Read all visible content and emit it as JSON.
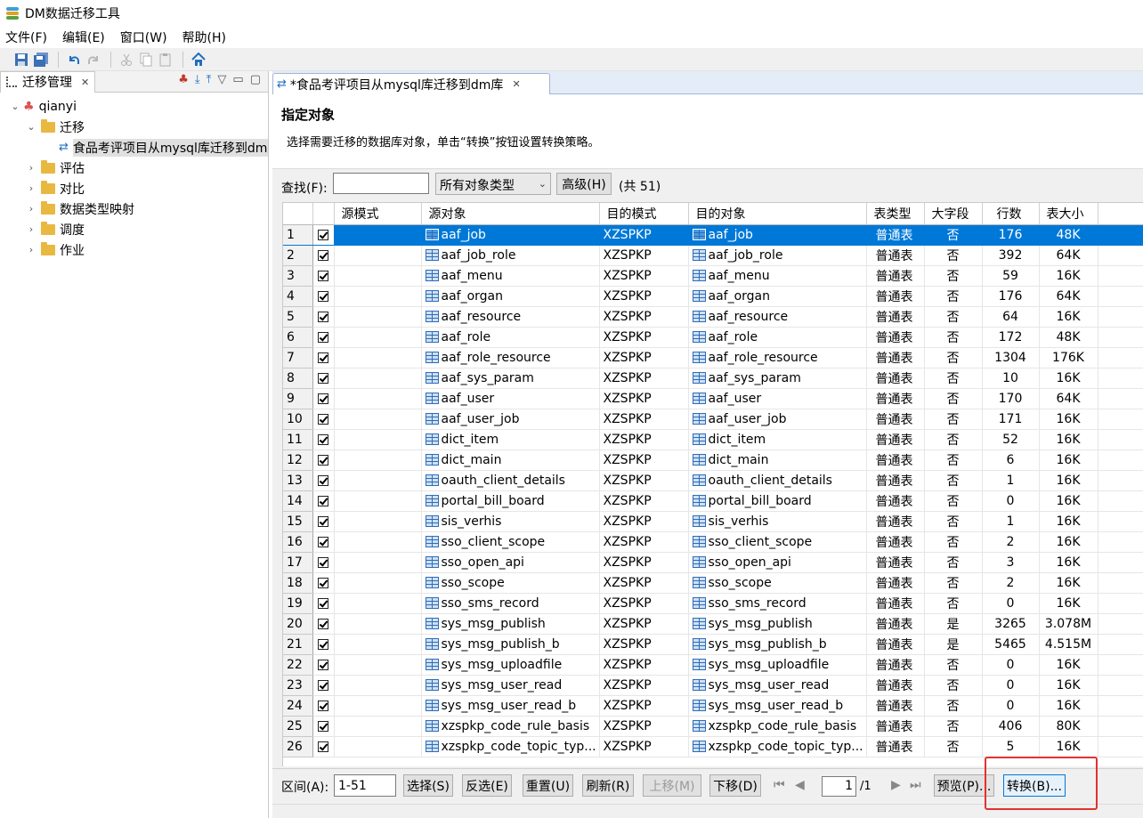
{
  "window": {
    "title": "DM数据迁移工具"
  },
  "menu": [
    "文件(F)",
    "编辑(E)",
    "窗口(W)",
    "帮助(H)"
  ],
  "left_panel": {
    "tab_label": "迁移管理",
    "tree": {
      "root": "qianyi",
      "migration_folder": "迁移",
      "migration_item": "食品考评项目从mysql库迁移到dm库",
      "folders": [
        "评估",
        "对比",
        "数据类型映射",
        "调度",
        "作业"
      ]
    }
  },
  "editor": {
    "tab_label": "*食品考评项目从mysql库迁移到dm库",
    "heading": "指定对象",
    "description": "选择需要迁移的数据库对象，单击“转换”按钮设置转换策略。",
    "search_label": "查找(F):",
    "search_value": "",
    "type_select": "所有对象类型",
    "advanced_button": "高级(H)",
    "count_text": "(共 51)",
    "columns": [
      "源模式",
      "源对象",
      "目的模式",
      "目的对象",
      "表类型",
      "大字段",
      "行数",
      "表大小"
    ],
    "rows": [
      {
        "n": "1",
        "obj": "aaf_job",
        "schema": "XZSPKP",
        "type": "普通表",
        "lob": "否",
        "rows": "176",
        "size": "48K"
      },
      {
        "n": "2",
        "obj": "aaf_job_role",
        "schema": "XZSPKP",
        "type": "普通表",
        "lob": "否",
        "rows": "392",
        "size": "64K"
      },
      {
        "n": "3",
        "obj": "aaf_menu",
        "schema": "XZSPKP",
        "type": "普通表",
        "lob": "否",
        "rows": "59",
        "size": "16K"
      },
      {
        "n": "4",
        "obj": "aaf_organ",
        "schema": "XZSPKP",
        "type": "普通表",
        "lob": "否",
        "rows": "176",
        "size": "64K"
      },
      {
        "n": "5",
        "obj": "aaf_resource",
        "schema": "XZSPKP",
        "type": "普通表",
        "lob": "否",
        "rows": "64",
        "size": "16K"
      },
      {
        "n": "6",
        "obj": "aaf_role",
        "schema": "XZSPKP",
        "type": "普通表",
        "lob": "否",
        "rows": "172",
        "size": "48K"
      },
      {
        "n": "7",
        "obj": "aaf_role_resource",
        "schema": "XZSPKP",
        "type": "普通表",
        "lob": "否",
        "rows": "1304",
        "size": "176K"
      },
      {
        "n": "8",
        "obj": "aaf_sys_param",
        "schema": "XZSPKP",
        "type": "普通表",
        "lob": "否",
        "rows": "10",
        "size": "16K"
      },
      {
        "n": "9",
        "obj": "aaf_user",
        "schema": "XZSPKP",
        "type": "普通表",
        "lob": "否",
        "rows": "170",
        "size": "64K"
      },
      {
        "n": "10",
        "obj": "aaf_user_job",
        "schema": "XZSPKP",
        "type": "普通表",
        "lob": "否",
        "rows": "171",
        "size": "16K"
      },
      {
        "n": "11",
        "obj": "dict_item",
        "schema": "XZSPKP",
        "type": "普通表",
        "lob": "否",
        "rows": "52",
        "size": "16K"
      },
      {
        "n": "12",
        "obj": "dict_main",
        "schema": "XZSPKP",
        "type": "普通表",
        "lob": "否",
        "rows": "6",
        "size": "16K"
      },
      {
        "n": "13",
        "obj": "oauth_client_details",
        "schema": "XZSPKP",
        "type": "普通表",
        "lob": "否",
        "rows": "1",
        "size": "16K"
      },
      {
        "n": "14",
        "obj": "portal_bill_board",
        "schema": "XZSPKP",
        "type": "普通表",
        "lob": "否",
        "rows": "0",
        "size": "16K"
      },
      {
        "n": "15",
        "obj": "sis_verhis",
        "schema": "XZSPKP",
        "type": "普通表",
        "lob": "否",
        "rows": "1",
        "size": "16K"
      },
      {
        "n": "16",
        "obj": "sso_client_scope",
        "schema": "XZSPKP",
        "type": "普通表",
        "lob": "否",
        "rows": "2",
        "size": "16K"
      },
      {
        "n": "17",
        "obj": "sso_open_api",
        "schema": "XZSPKP",
        "type": "普通表",
        "lob": "否",
        "rows": "3",
        "size": "16K"
      },
      {
        "n": "18",
        "obj": "sso_scope",
        "schema": "XZSPKP",
        "type": "普通表",
        "lob": "否",
        "rows": "2",
        "size": "16K"
      },
      {
        "n": "19",
        "obj": "sso_sms_record",
        "schema": "XZSPKP",
        "type": "普通表",
        "lob": "否",
        "rows": "0",
        "size": "16K"
      },
      {
        "n": "20",
        "obj": "sys_msg_publish",
        "schema": "XZSPKP",
        "type": "普通表",
        "lob": "是",
        "rows": "3265",
        "size": "3.078M"
      },
      {
        "n": "21",
        "obj": "sys_msg_publish_b",
        "schema": "XZSPKP",
        "type": "普通表",
        "lob": "是",
        "rows": "5465",
        "size": "4.515M"
      },
      {
        "n": "22",
        "obj": "sys_msg_uploadfile",
        "schema": "XZSPKP",
        "type": "普通表",
        "lob": "否",
        "rows": "0",
        "size": "16K"
      },
      {
        "n": "23",
        "obj": "sys_msg_user_read",
        "schema": "XZSPKP",
        "type": "普通表",
        "lob": "否",
        "rows": "0",
        "size": "16K"
      },
      {
        "n": "24",
        "obj": "sys_msg_user_read_b",
        "schema": "XZSPKP",
        "type": "普通表",
        "lob": "否",
        "rows": "0",
        "size": "16K"
      },
      {
        "n": "25",
        "obj": "xzspkp_code_rule_basis",
        "schema": "XZSPKP",
        "type": "普通表",
        "lob": "否",
        "rows": "406",
        "size": "80K"
      },
      {
        "n": "26",
        "obj": "xzspkp_code_topic_typ...",
        "schema": "XZSPKP",
        "type": "普通表",
        "lob": "否",
        "rows": "5",
        "size": "16K"
      }
    ],
    "bottom": {
      "range_label": "区间(A):",
      "range_value": "1-51",
      "select": "选择(S)",
      "invert": "反选(E)",
      "reset": "重置(U)",
      "refresh": "刷新(R)",
      "move_up": "上移(M)",
      "move_down": "下移(D)",
      "page_value": "1",
      "page_total": "/1",
      "preview": "预览(P)...",
      "convert": "转换(B)..."
    }
  },
  "colors": {
    "selection": "#0078d7",
    "highlight_box": "#e53030",
    "tab_accent": "#9fb6d8"
  }
}
